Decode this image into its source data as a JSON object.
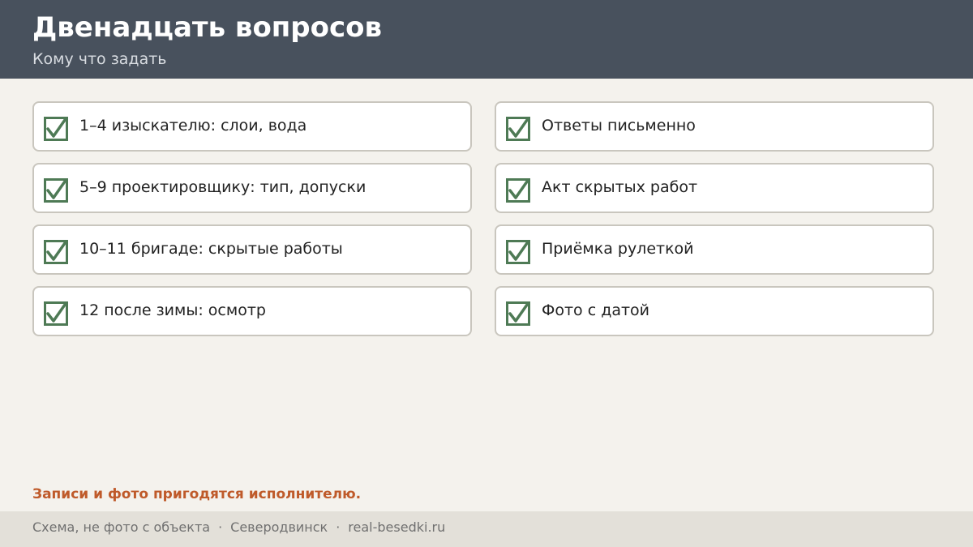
{
  "header": {
    "title": "Двенадцать вопросов",
    "subtitle": "Кому что задать"
  },
  "checklist": {
    "left": [
      {
        "text": "1–4 изыскателю: слои, вода",
        "checked": true
      },
      {
        "text": "5–9 проектировщику: тип, допуски",
        "checked": true
      },
      {
        "text": "10–11 бригаде: скрытые работы",
        "checked": true
      },
      {
        "text": "12 после зимы: осмотр",
        "checked": true
      }
    ],
    "right": [
      {
        "text": "Ответы письменно",
        "checked": true
      },
      {
        "text": "Акт скрытых работ",
        "checked": true
      },
      {
        "text": "Приёмка рулеткой",
        "checked": true
      },
      {
        "text": "Фото с датой",
        "checked": true
      }
    ]
  },
  "note": "Записи и фото пригодятся исполнителю.",
  "footer": {
    "part1": "Схема, не фото с объекта",
    "part2": "Северодвинск",
    "part3": "real-besedki.ru",
    "separator": "·"
  },
  "icons": {
    "check": "checkbox-checked-icon"
  },
  "colors": {
    "header_bg": "#48515d",
    "page_bg": "#f4f2ed",
    "check_green": "#4e7a55",
    "note_orange": "#bf5a2a",
    "footer_bg": "#e3e0d9"
  }
}
